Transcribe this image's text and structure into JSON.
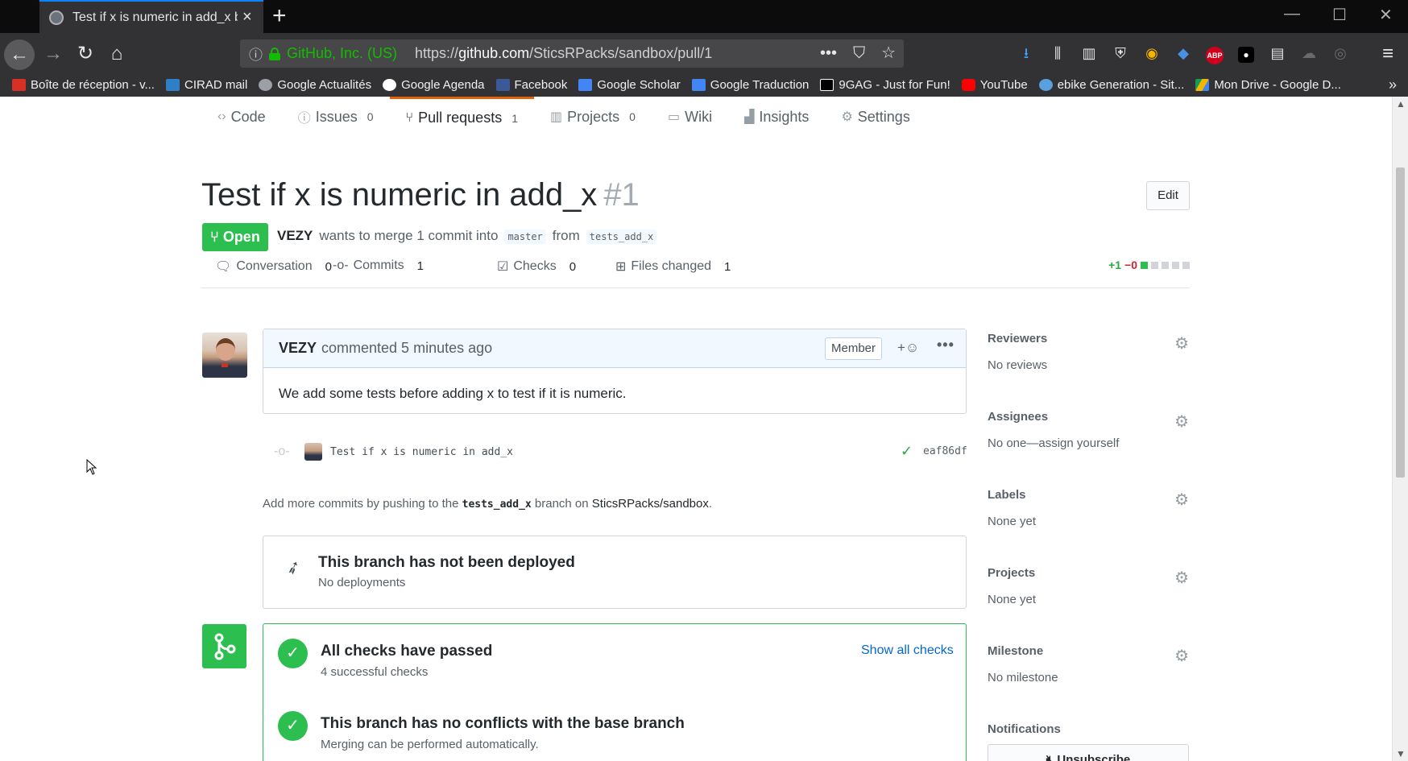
{
  "browser": {
    "tab": {
      "title": "Test if x is numeric in add_x by",
      "close": "×"
    },
    "new_tab": "+",
    "window_controls": {
      "minimize": "—",
      "maximize": "☐",
      "close": "✕"
    },
    "url": {
      "org": "GitHub, Inc. (US)",
      "prefix": "https://",
      "domain": "github.com",
      "path": "/SticsRPacks/sandbox/pull/1"
    },
    "url_actions": {
      "more": "•••",
      "pocket": "⛉",
      "star": "☆"
    },
    "bookmarks": [
      {
        "label": "Boîte de réception - v...",
        "icon": "gmail-icon",
        "color": "#d93025"
      },
      {
        "label": "CIRAD mail",
        "icon": "zimbra-icon",
        "color": "#2f7ec8"
      },
      {
        "label": "Google Actualités",
        "icon": "globe-icon",
        "color": "#9aa0a6"
      },
      {
        "label": "Google Agenda",
        "icon": "google-icon",
        "color": "#ffffff"
      },
      {
        "label": "Facebook",
        "icon": "facebook-icon",
        "color": "#3b5998"
      },
      {
        "label": "Google Scholar",
        "icon": "scholar-icon",
        "color": "#4285f4"
      },
      {
        "label": "Google Traduction",
        "icon": "translate-icon",
        "color": "#4285f4"
      },
      {
        "label": "9GAG - Just for Fun!",
        "icon": "9gag-icon",
        "color": "#000000"
      },
      {
        "label": "YouTube",
        "icon": "youtube-icon",
        "color": "#ff0000"
      },
      {
        "label": "ebike Generation - Sit...",
        "icon": "ebike-icon",
        "color": "#5aa0e0"
      },
      {
        "label": "Mon Drive - Google D...",
        "icon": "drive-icon",
        "color": "#0f9d58"
      }
    ],
    "bookmarks_more": "»"
  },
  "repo_nav": {
    "code": {
      "label": "Code"
    },
    "issues": {
      "label": "Issues",
      "count": "0"
    },
    "pulls": {
      "label": "Pull requests",
      "count": "1"
    },
    "projects": {
      "label": "Projects",
      "count": "0"
    },
    "wiki": {
      "label": "Wiki"
    },
    "insights": {
      "label": "Insights"
    },
    "settings": {
      "label": "Settings"
    }
  },
  "pr": {
    "title": "Test if x is numeric in add_x",
    "number": "#1",
    "edit_label": "Edit",
    "state": "Open",
    "author": "VEZY",
    "meta_text": "wants to merge 1 commit into",
    "base_branch": "master",
    "from_text": "from",
    "head_branch": "tests_add_x"
  },
  "tabs": {
    "conversation": {
      "label": "Conversation",
      "count": "0"
    },
    "commits": {
      "label": "Commits",
      "count": "1"
    },
    "checks": {
      "label": "Checks",
      "count": "0"
    },
    "files": {
      "label": "Files changed",
      "count": "1"
    },
    "diffstat": {
      "additions": "+1",
      "deletions": "−0"
    }
  },
  "comment": {
    "author": "VEZY",
    "action": "commented 5 minutes ago",
    "badge": "Member",
    "reaction": "+☺",
    "more": "•••",
    "body": "We add some tests before adding x to test if it is numeric."
  },
  "commit": {
    "message": "Test if x is numeric in add_x",
    "status": "✓",
    "sha": "eaf86df"
  },
  "push_hint": {
    "before": "Add more commits by pushing to the",
    "branch": "tests_add_x",
    "middle": "branch on",
    "repo": "SticsRPacks/sandbox",
    "end": "."
  },
  "deploy": {
    "title": "This branch has not been deployed",
    "subtitle": "No deployments"
  },
  "merge": {
    "checks_title": "All checks have passed",
    "checks_sub": "4 successful checks",
    "show_all": "Show all checks",
    "conflict_title": "This branch has no conflicts with the base branch",
    "conflict_sub": "Merging can be performed automatically."
  },
  "sidebar": {
    "reviewers": {
      "label": "Reviewers",
      "value": "No reviews"
    },
    "assignees": {
      "label": "Assignees",
      "value": "No one—assign yourself"
    },
    "labels": {
      "label": "Labels",
      "value": "None yet"
    },
    "projects": {
      "label": "Projects",
      "value": "None yet"
    },
    "milestone": {
      "label": "Milestone",
      "value": "No milestone"
    },
    "notifications": {
      "label": "Notifications"
    },
    "unsubscribe": "Unsubscribe"
  },
  "colors": {
    "open_green": "#2cbe4e",
    "link_blue": "#0366d6",
    "accent_orange": "#e36209"
  }
}
